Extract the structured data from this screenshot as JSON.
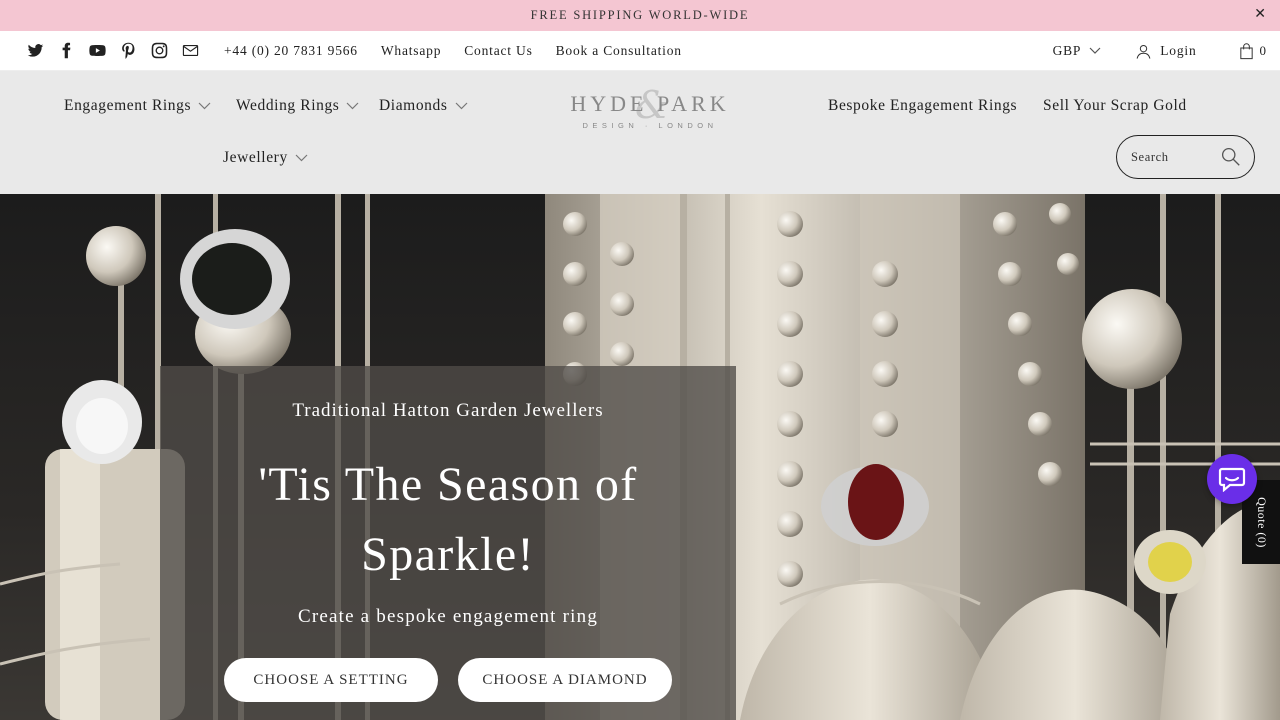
{
  "announcement": {
    "text": "FREE SHIPPING WORLD-WIDE",
    "close": "✕"
  },
  "topbar": {
    "social_icons": [
      "twitter-icon",
      "facebook-icon",
      "youtube-icon",
      "pinterest-icon",
      "instagram-icon",
      "email-icon"
    ],
    "links": [
      "+44 (0) 20 7831 9566",
      "Whatsapp",
      "Contact Us",
      "Book a Consultation"
    ],
    "currency": "GBP",
    "login": "Login",
    "cart_count": "0"
  },
  "header": {
    "nav_left": [
      "Engagement Rings",
      "Wedding Rings",
      "Diamonds",
      "Jewellery"
    ],
    "nav_right": [
      "Bespoke Engagement Rings",
      "Sell Your Scrap Gold"
    ],
    "logo_main": "HYDE PARK",
    "logo_sub": "DESIGN · LONDON",
    "search_placeholder": "Search"
  },
  "hero": {
    "kicker": "Traditional Hatton Garden Jewellers",
    "headline_line1": "'Tis The Season of",
    "headline_line2": "Sparkle!",
    "subline": "Create a bespoke engagement ring",
    "button1": "CHOOSE A SETTING",
    "button2": "CHOOSE A DIAMOND"
  },
  "quote_tab": "Quote (0)",
  "colors": {
    "announcement_bg": "#f4c6d2",
    "header_bg": "#e9e9e9",
    "chat_bg": "#6a2ee8"
  }
}
